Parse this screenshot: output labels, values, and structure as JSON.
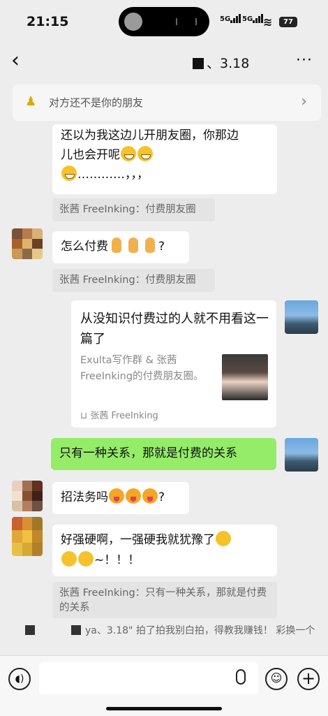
{
  "status_bar": {
    "time": "21:15",
    "signal1": "5G",
    "signal2": "5G",
    "battery": "77"
  },
  "nav": {
    "title": "、3.18",
    "more": "···"
  },
  "notice": {
    "text": "对方还不是你的朋友"
  },
  "messages": [
    {
      "id": "m1",
      "line1": "还以为我这边儿开朋友圈，你那边",
      "line2": "儿也会开呢",
      "line3": "…………，，，",
      "quote": "张茜 FreeInking：付费朋友圈"
    },
    {
      "id": "m2",
      "text": "怎么付费",
      "suffix": "?",
      "quote": "张茜 FreeInking：付费朋友圈"
    },
    {
      "id": "m3",
      "card_title": "从没知识付费过的人就不用看这一篇了",
      "card_desc": "Exulta写作群 & 张茜FreeInking的付费朋友圈。",
      "card_source": "张茜 FreeInking"
    },
    {
      "id": "m4",
      "text": "只有一种关系，那就是付费的关系"
    },
    {
      "id": "m5",
      "text": "招法务吗",
      "suffix": "?"
    },
    {
      "id": "m6",
      "line1": "好强硬啊，一强硬我就犹豫了",
      "line2": "~！！！",
      "quote": "张茜 FreeInking：只有一种关系，那就是付费的关系"
    }
  ],
  "system_message": "ya、3.18\" 拍了拍我别白拍，得教我赚钱！ 彩换一个"
}
